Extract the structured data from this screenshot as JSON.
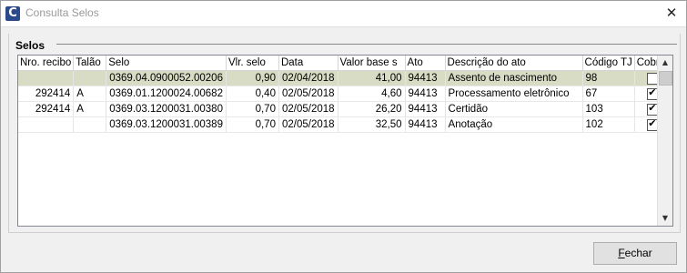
{
  "window": {
    "title": "Consulta Selos",
    "app_icon_letter": "C",
    "close_glyph": "✕"
  },
  "group": {
    "label": "Selos"
  },
  "table": {
    "columns": [
      "Nro. recibo",
      "Talão",
      "Selo",
      "Vlr. selo",
      "Data",
      "Valor base s",
      "Ato",
      "Descrição do ato",
      "Código TJ",
      "Cobrar"
    ],
    "rows": [
      {
        "recibo": "",
        "talao": "",
        "selo": "0369.04.0900052.00206",
        "vlr": "0,90",
        "data": "02/04/2018",
        "base": "41,00",
        "ato": "94413",
        "descricao": "Assento de nascimento",
        "codigo": "98",
        "cobrar": false
      },
      {
        "recibo": "292414",
        "talao": "A",
        "selo": "0369.01.1200024.00682",
        "vlr": "0,40",
        "data": "02/05/2018",
        "base": "4,60",
        "ato": "94413",
        "descricao": "Processamento eletrônico",
        "codigo": "67",
        "cobrar": true
      },
      {
        "recibo": "292414",
        "talao": "A",
        "selo": "0369.03.1200031.00380",
        "vlr": "0,70",
        "data": "02/05/2018",
        "base": "26,20",
        "ato": "94413",
        "descricao": "Certidão",
        "codigo": "103",
        "cobrar": true
      },
      {
        "recibo": "",
        "talao": "",
        "selo": "0369.03.1200031.00389",
        "vlr": "0,70",
        "data": "02/05/2018",
        "base": "32,50",
        "ato": "94413",
        "descricao": "Anotação",
        "codigo": "102",
        "cobrar": true
      }
    ]
  },
  "scrollbar": {
    "up_glyph": "▲",
    "down_glyph": "▼"
  },
  "buttons": {
    "close_mnemonic": "F",
    "close_rest": "echar"
  },
  "colors": {
    "selected_row": "#d8dcc5"
  }
}
